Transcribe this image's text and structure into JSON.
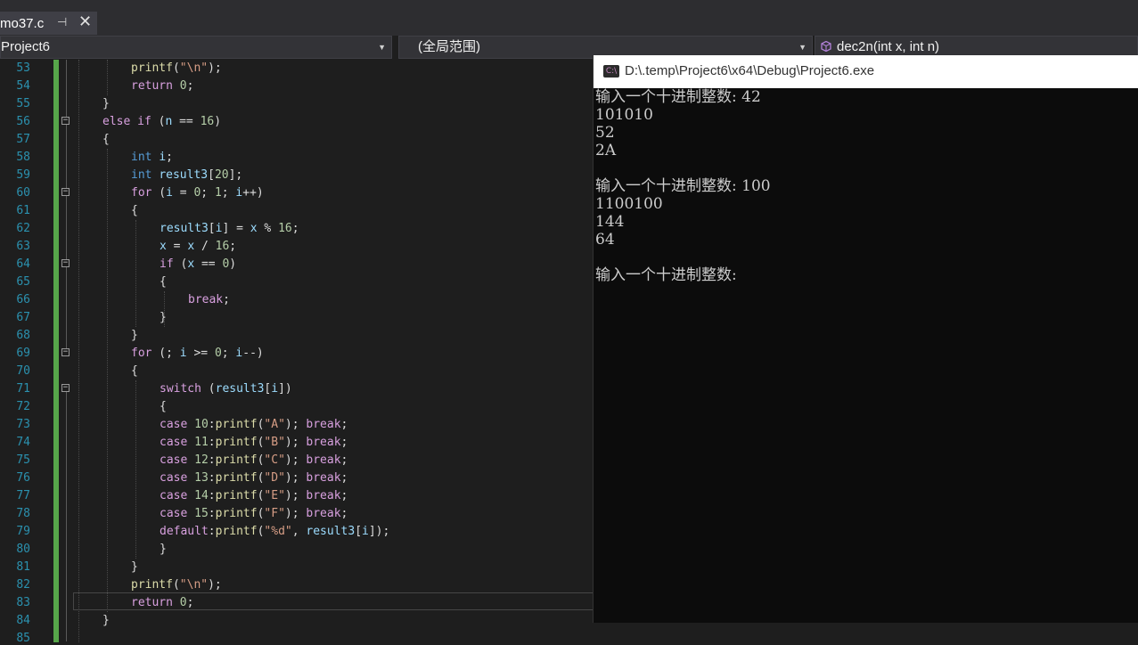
{
  "tab": {
    "name": "mo37.c",
    "pin": "⊣",
    "close": "✕"
  },
  "nav": {
    "project": "Project6",
    "scope": "(全局范围)",
    "member": "dec2n(int x, int n)"
  },
  "editor": {
    "line_numbers": [
      "53",
      "54",
      "55",
      "56",
      "57",
      "58",
      "59",
      "60",
      "61",
      "62",
      "63",
      "64",
      "65",
      "66",
      "67",
      "68",
      "69",
      "70",
      "71",
      "72",
      "73",
      "74",
      "75",
      "76",
      "77",
      "78",
      "79",
      "80",
      "81",
      "82",
      "83",
      "84",
      "85"
    ]
  },
  "console": {
    "title": "D:\\.temp\\Project6\\x64\\Debug\\Project6.exe",
    "icon_label": "C:\\",
    "lines": [
      "输入一个十进制整数: 42",
      "101010",
      "52",
      "2A",
      "",
      "输入一个十进制整数: 100",
      "1100100",
      "144",
      "64",
      "",
      "输入一个十进制整数:"
    ]
  },
  "colors": {
    "keyword": "#569cd6",
    "control": "#d8a0df",
    "string": "#d69d85",
    "function": "#dcdcaa",
    "variable": "#9cdcfe",
    "line_number": "#2b91af",
    "change_bar": "#57a64a"
  }
}
